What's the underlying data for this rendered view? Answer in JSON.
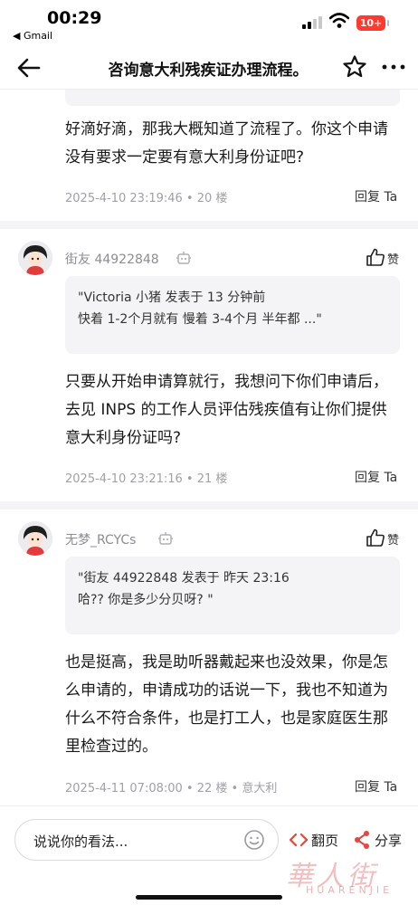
{
  "status_bar": {
    "time": "00:29",
    "back_app": "◀ Gmail",
    "battery": "10+"
  },
  "nav": {
    "title": "咨询意大利残疾证办理流程。"
  },
  "posts": [
    {
      "text": "好滴好滴，那我大概知道了流程了。你这个申请没有要求一定要有意大利身份证吧?",
      "meta": "2025-4-10 23:19:46 • 20 楼",
      "reply": "回复 Ta"
    },
    {
      "user": "街友 44922848",
      "like_label": "赞",
      "quote": [
        "\"Victoria 小猪 发表于 13 分钟前",
        "快着 1-2个月就有 慢着 3-4个月 半年都 ...\""
      ],
      "text": "只要从开始申请算就行，我想问下你们申请后，去见 INPS 的工作人员评估残疾值有让你们提供意大利身份证吗?",
      "meta": "2025-4-10 23:21:16 • 21 楼",
      "reply": "回复 Ta"
    },
    {
      "user": "无梦_RCYCs",
      "like_label": "赞",
      "quote": [
        "\"街友 44922848 发表于 昨天 23:16",
        "哈?? 你是多少分贝呀? \""
      ],
      "text": "也是挺高，我是助听器戴起来也没效果，你是怎么申请的，申请成功的话说一下，我也不知道为什么不符合条件，也是打工人，也是家庭医生那里检查过的。",
      "meta": "2025-4-11 07:08:00 • 22 楼 • 意大利",
      "reply": "回复 Ta"
    }
  ],
  "bottom_bar": {
    "comment_placeholder": "说说你的看法...",
    "flip_label": "翻页",
    "share_label": "分享"
  },
  "watermark": {
    "cn": "華人街",
    "en": "HUARENJIE"
  },
  "colors": {
    "accent_red": "#e8453c",
    "meta_gray": "#a0a0a6",
    "quote_bg": "#f4f4f6"
  }
}
